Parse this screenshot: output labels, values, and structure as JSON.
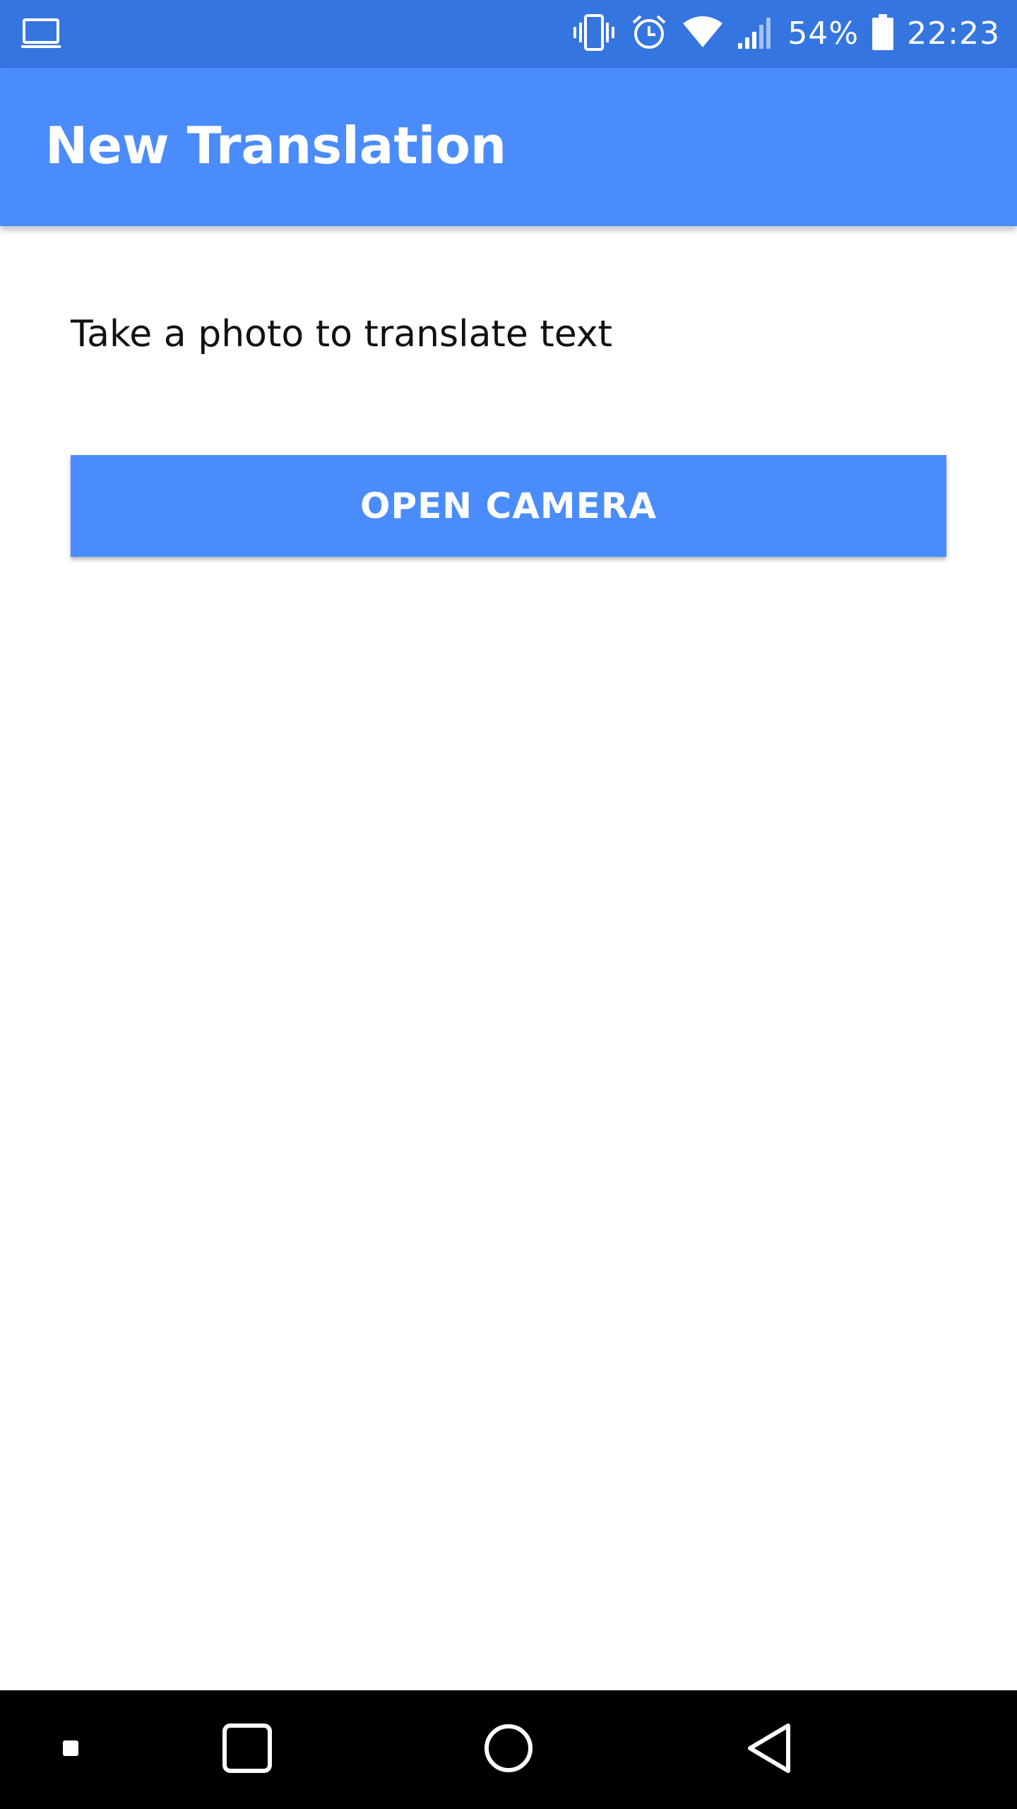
{
  "status_bar": {
    "left_icon": "laptop-icon",
    "icons": [
      "vibrate-icon",
      "alarm-clock-icon",
      "wifi-icon",
      "signal-icon",
      "battery-icon"
    ],
    "battery_percent": "54%",
    "time": "22:23",
    "background_color": "#3575e0"
  },
  "app_bar": {
    "title": "New Translation",
    "background_color": "#4a8cfb"
  },
  "main": {
    "instruction": "Take a photo to translate text",
    "open_camera_label": "OPEN CAMERA",
    "button_color": "#4a8cfb"
  },
  "nav_bar": {
    "buttons": [
      "menu-dot-icon",
      "recent-apps-icon",
      "home-icon",
      "back-icon"
    ]
  }
}
